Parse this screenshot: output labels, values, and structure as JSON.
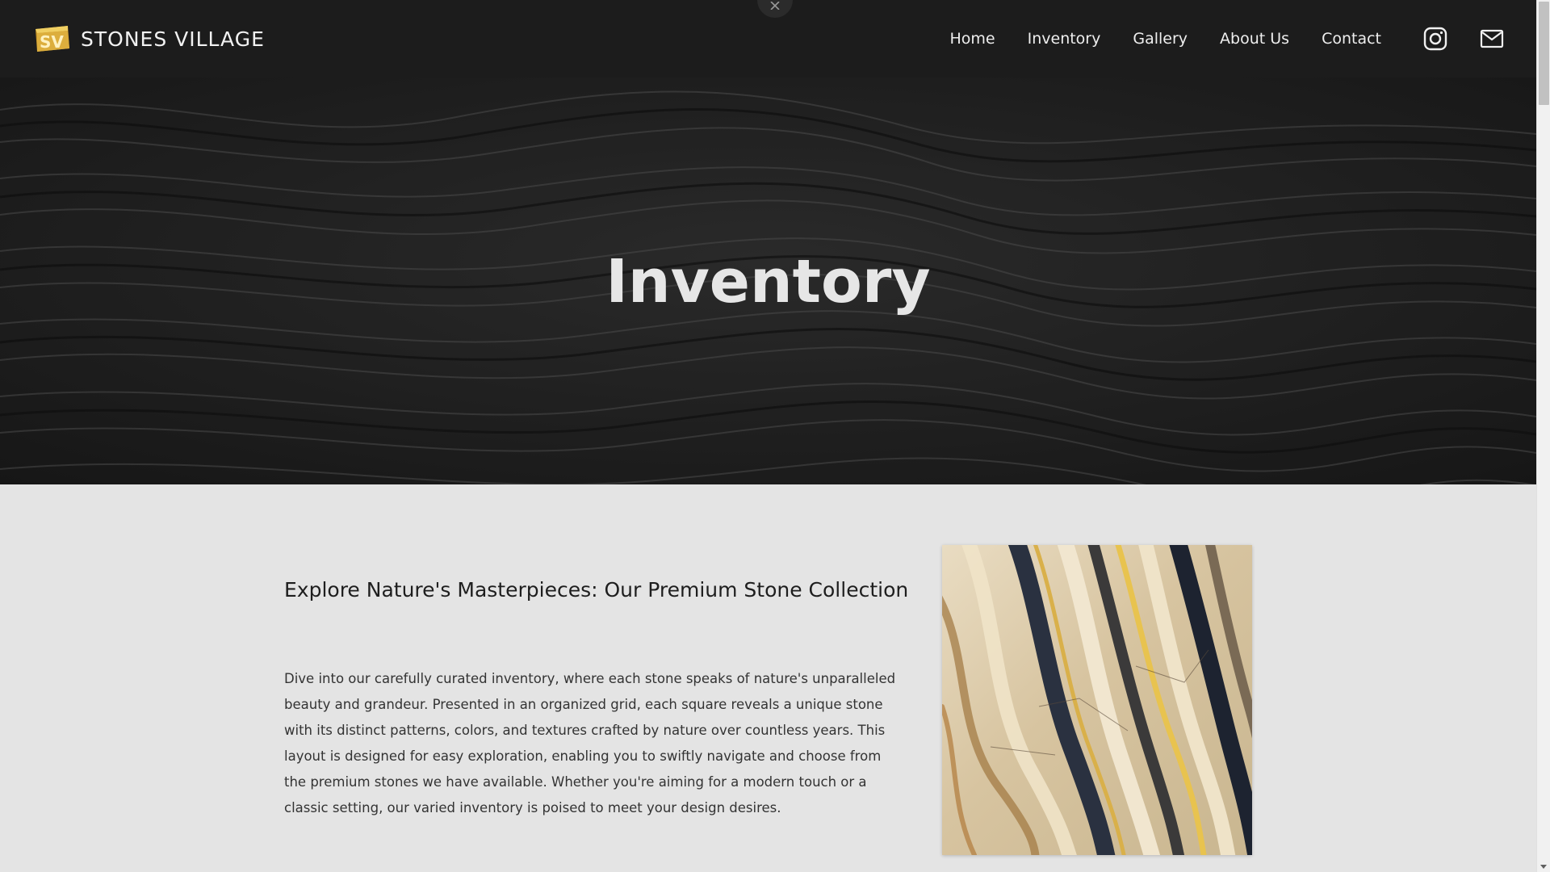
{
  "brand": {
    "name": "STONES VILLAGE",
    "logo_mark": "SV",
    "logo_color": "#e6b93a"
  },
  "nav": {
    "items": [
      {
        "label": "Home"
      },
      {
        "label": "Inventory"
      },
      {
        "label": "Gallery"
      },
      {
        "label": "About Us"
      },
      {
        "label": "Contact"
      }
    ],
    "icons": [
      "instagram-icon",
      "mail-icon"
    ]
  },
  "hero": {
    "title": "Inventory"
  },
  "intro": {
    "heading": "Explore Nature's Masterpieces: Our Premium Stone Collection",
    "body": "Dive into our carefully curated inventory, where each stone speaks of nature's unparalleled beauty and grandeur. Presented in an organized grid, each square reveals a unique stone with its distinct patterns, colors, and textures crafted by nature over countless years. This layout is designed for easy exploration, enabling you to swiftly navigate and choose from the premium stones we have available. Whether you're aiming for a modern touch or a classic setting, our varied inventory is poised to meet your design desires."
  },
  "colors": {
    "header_bg": "#1c1c1c",
    "hero_bg": "#1f1f1f",
    "content_bg": "#e4e4e4",
    "heading_text": "#1e1e1e",
    "body_text": "#333333"
  }
}
